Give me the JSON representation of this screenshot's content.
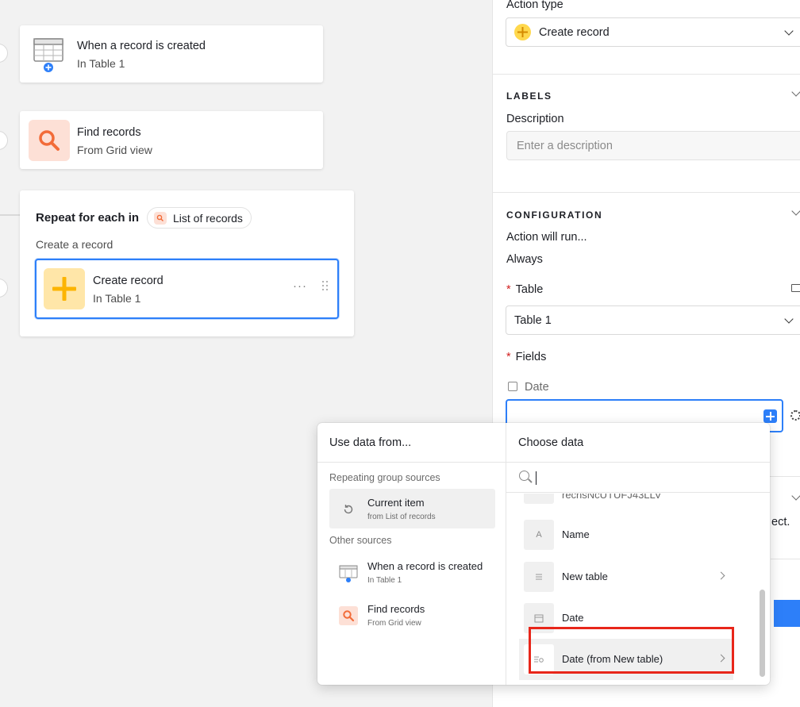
{
  "canvas": {
    "trigger": {
      "title": "When a record is created",
      "subtitle": "In Table 1"
    },
    "find": {
      "title": "Find records",
      "subtitle": "From Grid view"
    },
    "repeat": {
      "title": "Repeat for each in",
      "pill_label": "List of records",
      "subtitle": "Create a record",
      "inner": {
        "title": "Create record",
        "subtitle": "In Table 1",
        "more": "···"
      }
    }
  },
  "panel": {
    "action_type_label": "Action type",
    "action_type_value": "Create record",
    "labels_section": "LABELS",
    "description_label": "Description",
    "description_placeholder": "Enter a description",
    "config_section": "CONFIGURATION",
    "action_will_run_label": "Action will run...",
    "action_will_run_value": "Always",
    "table_label": "Table",
    "table_value": "Table 1",
    "fields_label": "Fields",
    "date_field_label": "Date",
    "required_mark": "*",
    "partial_text": "ect."
  },
  "popover": {
    "left_title": "Use data from...",
    "repeating_group": "Repeating group sources",
    "current_item": {
      "title": "Current item",
      "subtitle": "from List of records"
    },
    "other_group": "Other sources",
    "sources": [
      {
        "title": "When a record is created",
        "subtitle": "In Table 1"
      },
      {
        "title": "Find records",
        "subtitle": "From Grid view"
      }
    ],
    "right_title": "Choose data",
    "search_placeholder": "",
    "partial_field": "recnsNcUTUFJ43LLV",
    "fields": [
      {
        "name": "Name",
        "icon": "A"
      },
      {
        "name": "New table",
        "icon": "link-icon"
      },
      {
        "name": "Date",
        "icon": "calendar-icon"
      },
      {
        "name": "Date (from New table)",
        "icon": "lookup-icon"
      }
    ]
  },
  "colors": {
    "accent": "#2d7ff9",
    "highlight": "#e8261a",
    "find_icon_bg": "#fde0d6",
    "create_icon_bg": "#ffe6a8"
  }
}
